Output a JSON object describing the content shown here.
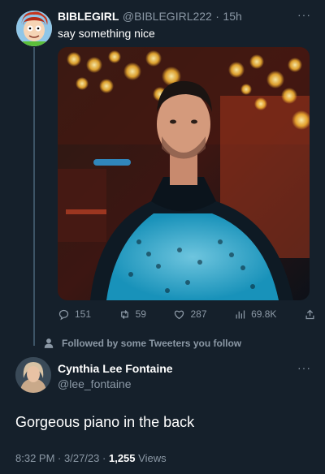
{
  "tweet1": {
    "display_name": "BIBLEGIRL",
    "handle": "@BIBLEGIRL222",
    "separator": "·",
    "time_ago": "15h",
    "text": "say something nice",
    "more_label": "···",
    "actions": {
      "replies": "151",
      "retweets": "59",
      "likes": "287",
      "views": "69.8K"
    }
  },
  "followed_banner": "Followed by some Tweeters you follow",
  "tweet2": {
    "display_name": "Cynthia Lee Fontaine",
    "handle": "@lee_fontaine",
    "more_label": "···",
    "text": "Gorgeous piano in the back",
    "time": "8:32 PM",
    "date": "3/27/23",
    "separator": "·",
    "views_count": "1,255",
    "views_label": "Views"
  },
  "colors": {
    "background": "#15202b",
    "secondary_text": "#8b98a5",
    "primary_text": "#ffffff"
  }
}
